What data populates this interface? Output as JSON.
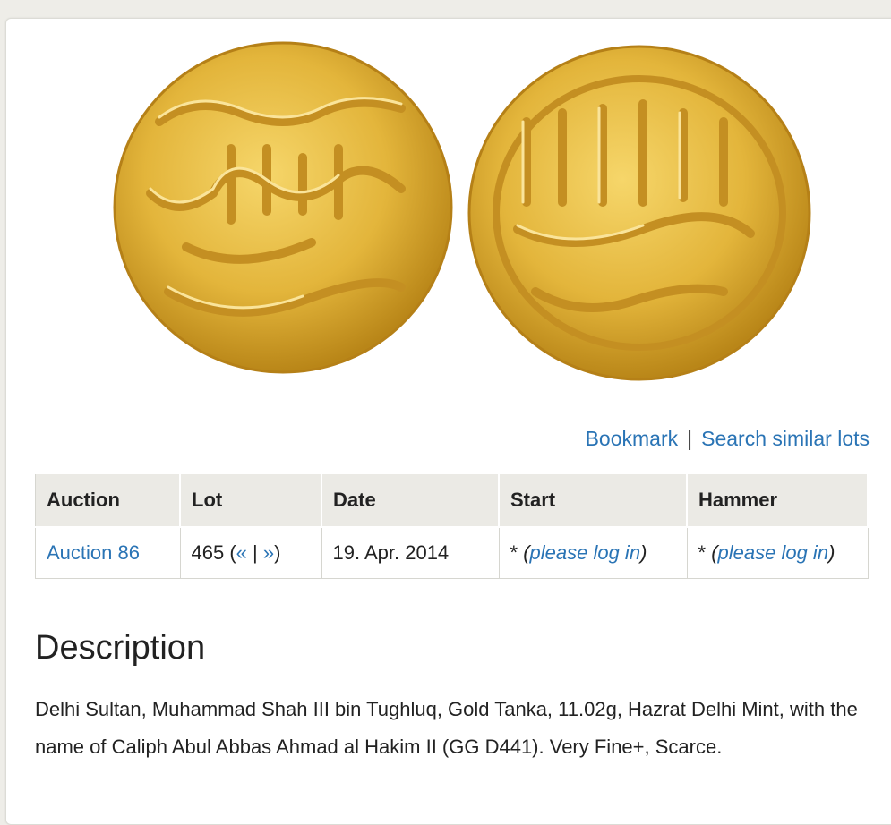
{
  "links": {
    "bookmark": "Bookmark",
    "separator": "|",
    "search_similar": "Search similar lots"
  },
  "table": {
    "headers": [
      "Auction",
      "Lot",
      "Date",
      "Start",
      "Hammer"
    ],
    "row": {
      "auction": "Auction 86",
      "lot_number": "465",
      "lot_prev": "«",
      "lot_sep": "|",
      "lot_next": "»",
      "date": "19. Apr. 2014",
      "start_star": "*",
      "start_login": "please log in",
      "hammer_star": "*",
      "hammer_login": "please log in"
    }
  },
  "description": {
    "title": "Description",
    "text": "Delhi Sultan, Muhammad Shah III bin Tughluq, Gold Tanka, 11.02g, Hazrat Delhi Mint, with the name of Caliph Abul Abbas Ahmad al Hakim II (GG D441). Very Fine+, Scarce."
  },
  "colors": {
    "link": "#2a74b5",
    "gold": "#e0b43a",
    "header_bg": "#ebeae5"
  },
  "image": {
    "subject": "gold-tanka-coin-obverse-reverse"
  }
}
